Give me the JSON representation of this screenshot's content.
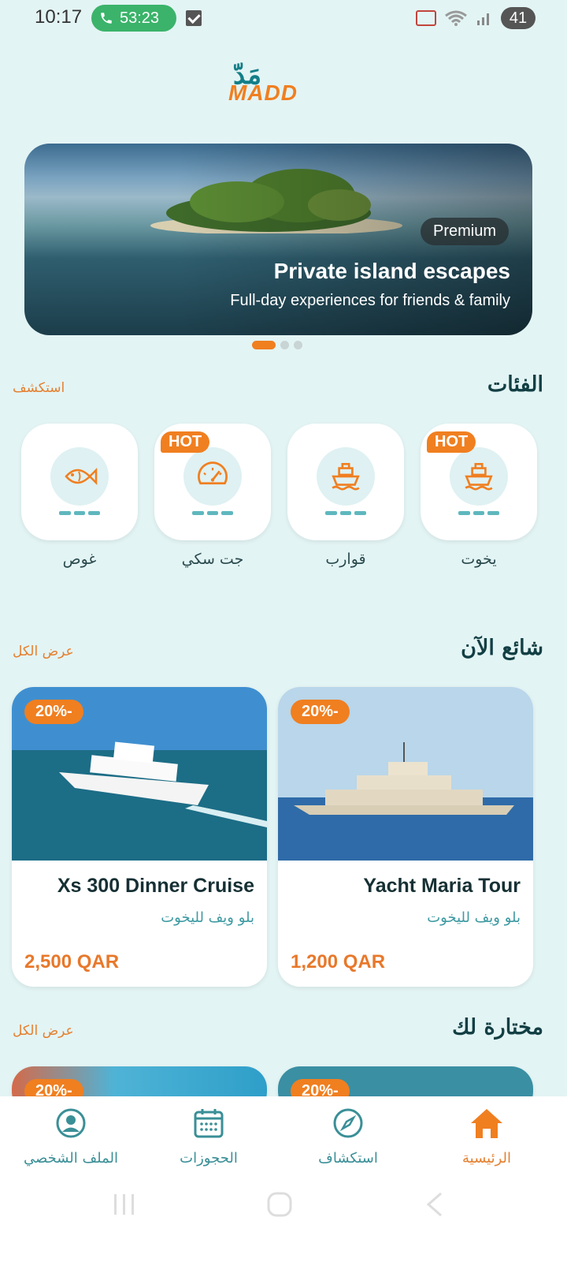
{
  "status_bar": {
    "time": "10:17",
    "call_timer": "53:23",
    "battery": "41"
  },
  "logo": {
    "arabic": "مَدّ",
    "english": "MADD"
  },
  "hero": {
    "badge": "Premium",
    "title": "Private island escapes",
    "subtitle": "Full-day experiences for friends & family"
  },
  "categories": {
    "title": "الفئات",
    "link": "استكشف",
    "items": [
      {
        "label": "يخوت",
        "hot": "HOT",
        "icon": "ship-icon"
      },
      {
        "label": "قوارب",
        "hot": "",
        "icon": "ship-icon"
      },
      {
        "label": "جت سكي",
        "hot": "HOT",
        "icon": "speedometer-icon"
      },
      {
        "label": "غوص",
        "hot": "",
        "icon": "fish-icon"
      }
    ]
  },
  "trending": {
    "title": "شائع الآن",
    "link": "عرض الكل",
    "cards": [
      {
        "discount": "20%-",
        "title": "Yacht Maria Tour",
        "subtitle": "بلو ويف لليخوت",
        "price": "1,200 QAR"
      },
      {
        "discount": "20%-",
        "title": "Xs 300 Dinner Cruise",
        "subtitle": "بلو ويف لليخوت",
        "price": "2,500 QAR"
      }
    ]
  },
  "picked": {
    "title": "مختارة لك",
    "link": "عرض الكل",
    "cards": [
      {
        "discount": "20%-"
      },
      {
        "discount": "20%-"
      }
    ]
  },
  "bottom_nav": [
    {
      "label": "الرئيسية",
      "icon": "home-icon",
      "active": true
    },
    {
      "label": "استكشاف",
      "icon": "compass-icon",
      "active": false
    },
    {
      "label": "الحجوزات",
      "icon": "calendar-icon",
      "active": false
    },
    {
      "label": "الملف الشخصي",
      "icon": "profile-icon",
      "active": false
    }
  ],
  "colors": {
    "accent": "#f07f20",
    "teal": "#137e88",
    "background": "#e3f4f4"
  }
}
